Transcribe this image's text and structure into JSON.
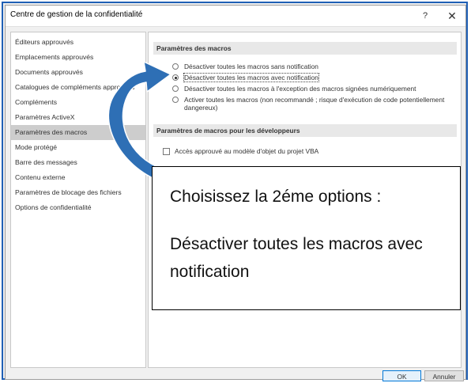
{
  "window": {
    "title": "Centre de gestion de la confidentialité",
    "help_label": "?",
    "close_label": "✕"
  },
  "sidebar": {
    "items": [
      {
        "label": "Éditeurs approuvés"
      },
      {
        "label": "Emplacements approuvés"
      },
      {
        "label": "Documents approuvés"
      },
      {
        "label": "Catalogues de compléments approuvés"
      },
      {
        "label": "Compléments"
      },
      {
        "label": "Paramètres ActiveX"
      },
      {
        "label": "Paramètres des macros",
        "selected": true
      },
      {
        "label": "Mode protégé"
      },
      {
        "label": "Barre des messages"
      },
      {
        "label": "Contenu externe"
      },
      {
        "label": "Paramètres de blocage des fichiers"
      },
      {
        "label": "Options de confidentialité"
      }
    ]
  },
  "macro_settings": {
    "header": "Paramètres des macros",
    "options": [
      {
        "label": "Désactiver toutes les macros sans notification",
        "checked": false
      },
      {
        "label": "Désactiver toutes les macros avec notification",
        "checked": true
      },
      {
        "label": "Désactiver toutes les macros à l'exception des macros signées numériquement",
        "checked": false
      },
      {
        "label": "Activer toutes les macros (non recommandé ; risque d'exécution de code potentiellement dangereux)",
        "checked": false
      }
    ]
  },
  "developer_settings": {
    "header": "Paramètres de macros pour les développeurs",
    "checkbox_label": "Accès approuvé au modèle d'objet du projet VBA",
    "checked": false
  },
  "buttons": {
    "ok": "OK",
    "cancel": "Annuler"
  },
  "annotation": {
    "line1": "Choisissez la 2éme options :",
    "line2": "Désactiver toutes les macros avec notification",
    "arrow_color": "#2e6fb5"
  }
}
